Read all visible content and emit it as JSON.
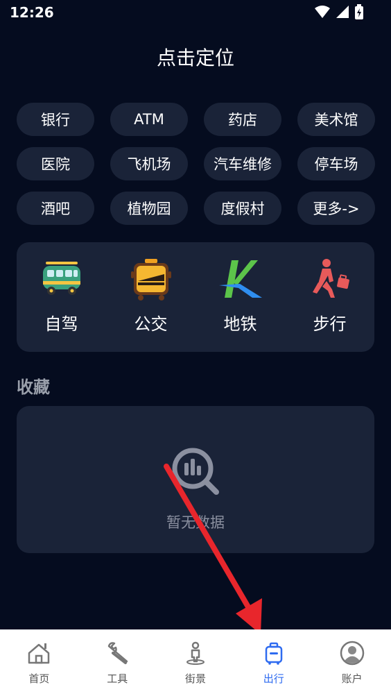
{
  "status_bar": {
    "time": "12:26"
  },
  "header": {
    "title": "点击定位"
  },
  "categories": [
    "银行",
    "ATM",
    "药店",
    "美术馆",
    "医院",
    "飞机场",
    "汽车维修",
    "停车场",
    "酒吧",
    "植物园",
    "度假村",
    "更多->"
  ],
  "transport": {
    "modes": [
      {
        "label": "自驾",
        "icon": "van-icon"
      },
      {
        "label": "公交",
        "icon": "bus-icon"
      },
      {
        "label": "地铁",
        "icon": "metro-icon"
      },
      {
        "label": "步行",
        "icon": "walking-icon"
      }
    ]
  },
  "favorites": {
    "title": "收藏",
    "empty_text": "暂无数据"
  },
  "bottom_nav": {
    "items": [
      {
        "label": "首页",
        "icon": "home-icon"
      },
      {
        "label": "工具",
        "icon": "wrench-icon"
      },
      {
        "label": "街景",
        "icon": "streetview-icon"
      },
      {
        "label": "出行",
        "icon": "travel-icon",
        "active": true
      },
      {
        "label": "账户",
        "icon": "account-icon"
      }
    ]
  },
  "colors": {
    "background": "#050c1f",
    "card": "#1a2338",
    "accent": "#2e6bf0",
    "annotation_arrow": "#e8262c"
  }
}
